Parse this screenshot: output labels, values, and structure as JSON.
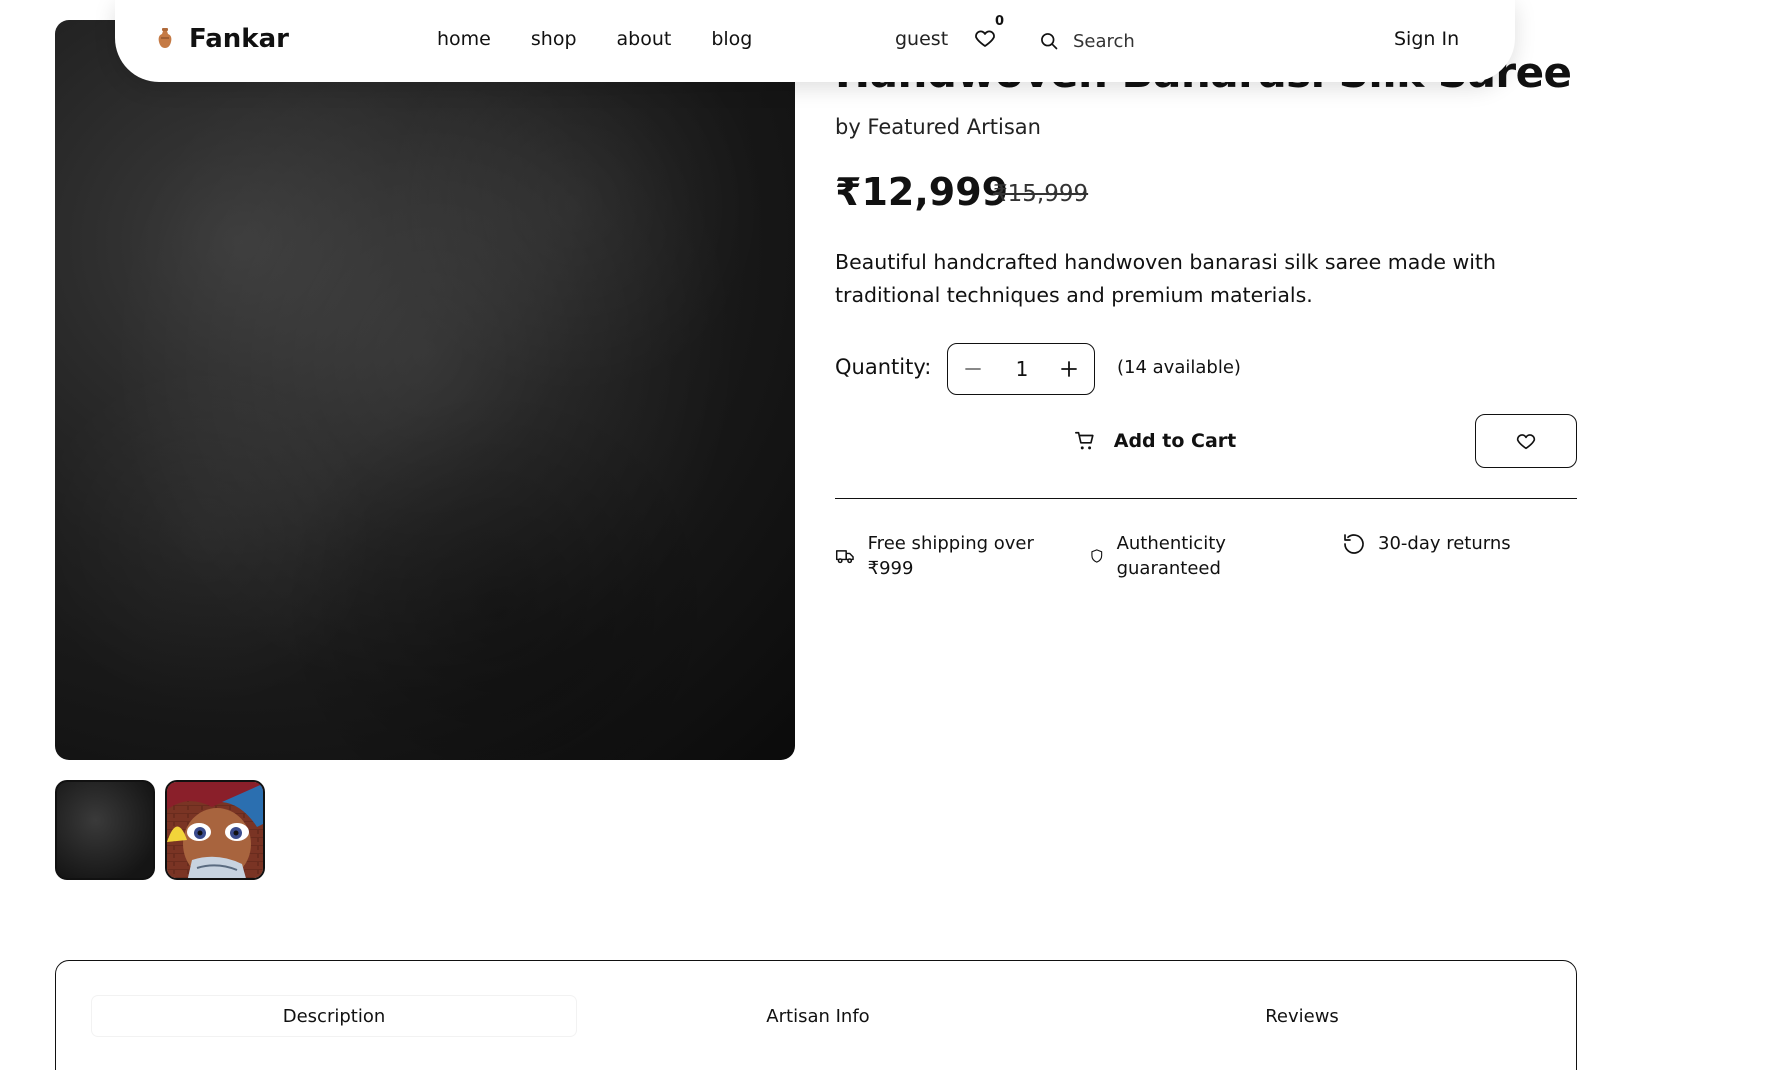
{
  "navbar": {
    "brand": "Fankar",
    "links": [
      "home",
      "shop",
      "about",
      "blog"
    ],
    "user": "guest",
    "wishlist_count": "0",
    "search_placeholder": "Search",
    "sign_in": "Sign In"
  },
  "product": {
    "title": "Handwoven Banarasi Silk Saree",
    "artisan": "by Featured Artisan",
    "price": "₹12,999",
    "original_price": "₹15,999",
    "description": "Beautiful handcrafted handwoven banarasi silk saree made with traditional techniques and premium materials.",
    "quantity_label": "Quantity:",
    "quantity_value": "1",
    "available": "(14 available)",
    "add_to_cart": "Add to Cart"
  },
  "features": [
    {
      "icon": "truck-icon",
      "text": "Free shipping over ₹999"
    },
    {
      "icon": "shield-icon",
      "text": "Authenticity guaranteed"
    },
    {
      "icon": "rotate-ccw-icon",
      "text": "30-day returns"
    }
  ],
  "gallery": {
    "thumbnails": [
      "dark-texture",
      "comic-character"
    ]
  },
  "tabs": [
    "Description",
    "Artisan Info",
    "Reviews"
  ],
  "colors": {
    "text": "#111111",
    "background": "#ffffff",
    "image_dark": "#1a1a1a"
  }
}
